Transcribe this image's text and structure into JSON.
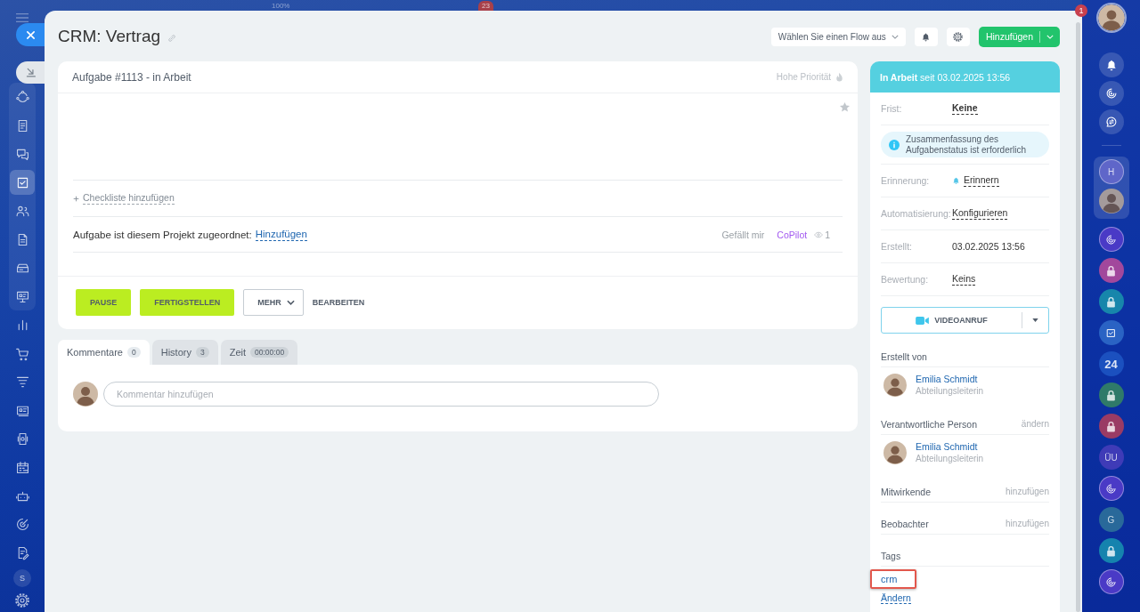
{
  "background_page": {
    "zoom_label": "100%",
    "counter_badge": "23"
  },
  "left_sidebar": {
    "items": [
      {
        "selected": false
      },
      {
        "selected": false
      },
      {
        "selected": false
      },
      {
        "selected": true
      },
      {
        "selected": false
      },
      {
        "selected": false
      },
      {
        "selected": false
      },
      {
        "selected": false
      },
      {
        "selected": false
      },
      {
        "selected": false
      },
      {
        "selected": false
      },
      {
        "selected": false
      },
      {
        "selected": false
      },
      {
        "selected": false
      },
      {
        "selected": false
      },
      {
        "selected": false
      },
      {
        "selected": false
      }
    ],
    "user_initial": "S"
  },
  "right_sidebar": {
    "notification_badge": "1",
    "pinned": [
      {
        "kind": "text",
        "text": "H",
        "color": "#5f66c9"
      },
      {
        "kind": "avatar"
      }
    ],
    "chats": [
      {
        "kind": "copilot",
        "color": "#4a3ac6"
      },
      {
        "kind": "lock",
        "color": "#a2489c"
      },
      {
        "kind": "lock",
        "color": "#1786ab"
      },
      {
        "kind": "task",
        "color": "#2a63c4"
      },
      {
        "kind": "logo",
        "text": "24",
        "color": "#1b50bf"
      },
      {
        "kind": "lock",
        "color": "#2f7a69"
      },
      {
        "kind": "lock",
        "color": "#9a3b64"
      },
      {
        "kind": "text",
        "text": "ÜU",
        "color": "#3f3bb7"
      },
      {
        "kind": "copilot",
        "color": "#4a3ac6"
      },
      {
        "kind": "text",
        "text": "G",
        "color": "#29699a"
      },
      {
        "kind": "lock",
        "color": "#1583ae"
      },
      {
        "kind": "copilot",
        "color": "#4a3ac6"
      }
    ]
  },
  "header": {
    "title": "CRM: Vertrag",
    "flow_select": "Wählen Sie einen Flow aus",
    "add_button": "Hinzufügen"
  },
  "task": {
    "heading": "Aufgabe #1113 - in Arbeit",
    "priority": {
      "label": "Hohe Priorität",
      "on": false
    },
    "favorite": false,
    "checklist_link": "Checkliste hinzufügen",
    "project": {
      "label": "Aufgabe ist diesem Projekt zugeordnet:",
      "link": "Hinzufügen"
    },
    "like": "Gefällt mir",
    "copilot": "CoPilot",
    "views": "1",
    "buttons": [
      {
        "label": "PAUSE",
        "kind": "primary"
      },
      {
        "label": "FERTIGSTELLEN",
        "kind": "primary"
      },
      {
        "label": "MEHR",
        "kind": "dropdown"
      },
      {
        "label": "BEARBEITEN",
        "kind": "link"
      }
    ]
  },
  "tabs": [
    {
      "label": "Kommentare",
      "count": "0",
      "selected": true
    },
    {
      "label": "History",
      "count": "3",
      "selected": false
    },
    {
      "label": "Zeit",
      "count": "00:00:00",
      "selected": false
    }
  ],
  "comment": {
    "placeholder": "Kommentar hinzufügen"
  },
  "status_panel": {
    "status": "**In Arbeit** seit 03.02.2025 13:56",
    "fields": [
      {
        "kind": "deadline",
        "label": "Frist:",
        "value": "Keine"
      },
      {
        "kind": "notice",
        "text": "Zusammenfassung des Aufgabenstatus ist erforderlich"
      },
      {
        "kind": "reminder",
        "label": "Erinnerung:",
        "value": "Erinnern"
      },
      {
        "kind": "link",
        "label": "Automatisierung:",
        "value": "Konfigurieren"
      },
      {
        "kind": "text",
        "label": "Erstellt:",
        "value": "03.02.2025 13:56"
      },
      {
        "kind": "link",
        "label": "Bewertung:",
        "value": "Keins"
      }
    ],
    "video_button": "VIDEOANRUF",
    "roles": [
      {
        "title": "Erstellt von",
        "people": [
          {
            "name": "Emilia Schmidt",
            "position": "Abteilungsleiterin"
          }
        ]
      },
      {
        "title": "Verantwortliche Person",
        "action": "ändern",
        "people": [
          {
            "name": "Emilia Schmidt",
            "position": "Abteilungsleiterin"
          }
        ]
      },
      {
        "title": "Mitwirkende",
        "action": "hinzufügen"
      },
      {
        "title": "Beobachter",
        "action": "hinzufügen"
      }
    ],
    "tags": {
      "title": "Tags",
      "items": [
        {
          "label": "crm",
          "highlighted": true
        }
      ],
      "edit_link": "Ändern"
    }
  }
}
